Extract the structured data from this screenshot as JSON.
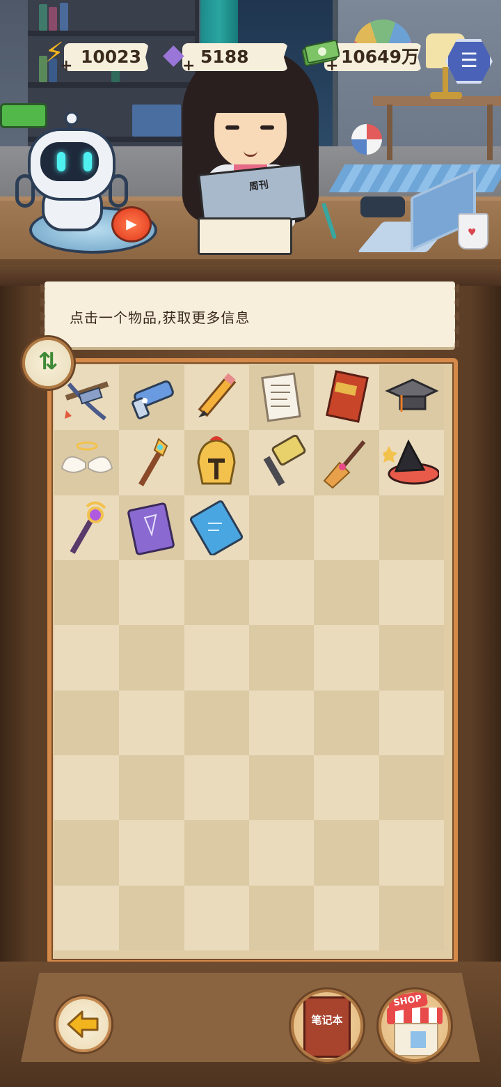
{
  "resources": {
    "energy": {
      "icon": "lightning-icon",
      "value": "10023"
    },
    "gems": {
      "icon": "gem-icon",
      "value": "5188"
    },
    "cash": {
      "icon": "cash-icon",
      "value": "10649万"
    }
  },
  "scene": {
    "magazine_text": "周刊"
  },
  "info": {
    "hint": "点击一个物品,获取更多信息"
  },
  "inventory": {
    "columns": 6,
    "rows": 9,
    "items": [
      {
        "name": "crossbow",
        "icon": "crossbow-icon"
      },
      {
        "name": "blaster-gun",
        "icon": "blaster-gun-icon"
      },
      {
        "name": "pencil",
        "icon": "pencil-icon"
      },
      {
        "name": "paper-scroll",
        "icon": "scroll-icon"
      },
      {
        "name": "exam-book",
        "icon": "book-icon",
        "text": "3年高考"
      },
      {
        "name": "graduation-cap",
        "icon": "graduation-cap-icon"
      },
      {
        "name": "angel-wings",
        "icon": "angel-wings-icon"
      },
      {
        "name": "golden-staff",
        "icon": "golden-staff-icon"
      },
      {
        "name": "spartan-helmet",
        "icon": "helmet-icon"
      },
      {
        "name": "war-hammer",
        "icon": "hammer-icon"
      },
      {
        "name": "broom",
        "icon": "broom-icon"
      },
      {
        "name": "witch-hat",
        "icon": "witch-hat-icon"
      },
      {
        "name": "magic-scepter",
        "icon": "scepter-icon"
      },
      {
        "name": "spell-book",
        "icon": "spell-book-icon"
      },
      {
        "name": "memory-card",
        "icon": "memory-card-icon"
      }
    ]
  },
  "bottom": {
    "notebook_label": "笔记本",
    "shop_label": "SHOP"
  },
  "colors": {
    "panel_bg": "#eadbbd",
    "frame": "#d58a4a",
    "text_dark": "#3a2a1e",
    "battery": "#52b84a"
  }
}
